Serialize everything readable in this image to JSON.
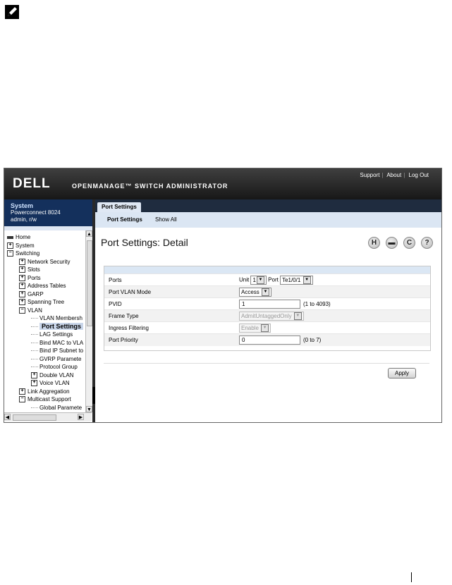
{
  "header": {
    "logo": "DELL",
    "product": "OPENMANAGE™ SWITCH ADMINISTRATOR",
    "links": [
      "Support",
      "About",
      "Log Out"
    ]
  },
  "system_panel": {
    "title": "System",
    "model": "Powerconnect 8024",
    "user": "admin, r/w"
  },
  "tree": [
    {
      "label": "Home",
      "indent": 0,
      "icon": "home"
    },
    {
      "label": "System",
      "indent": 0,
      "icon": "plus"
    },
    {
      "label": "Switching",
      "indent": 0,
      "icon": "minus"
    },
    {
      "label": "Network Security",
      "indent": 1,
      "icon": "plus"
    },
    {
      "label": "Slots",
      "indent": 1,
      "icon": "plus"
    },
    {
      "label": "Ports",
      "indent": 1,
      "icon": "plus"
    },
    {
      "label": "Address Tables",
      "indent": 1,
      "icon": "plus"
    },
    {
      "label": "GARP",
      "indent": 1,
      "icon": "plus"
    },
    {
      "label": "Spanning Tree",
      "indent": 1,
      "icon": "plus"
    },
    {
      "label": "VLAN",
      "indent": 1,
      "icon": "minus"
    },
    {
      "label": "VLAN Membersh",
      "indent": 2,
      "icon": "none"
    },
    {
      "label": "Port Settings",
      "indent": 2,
      "icon": "none",
      "selected": true
    },
    {
      "label": "LAG Settings",
      "indent": 2,
      "icon": "none"
    },
    {
      "label": "Bind MAC to VLA",
      "indent": 2,
      "icon": "none"
    },
    {
      "label": "Bind IP Subnet to",
      "indent": 2,
      "icon": "none"
    },
    {
      "label": "GVRP Paramete",
      "indent": 2,
      "icon": "none"
    },
    {
      "label": "Protocol Group",
      "indent": 2,
      "icon": "none"
    },
    {
      "label": "Double VLAN",
      "indent": 2,
      "icon": "plus"
    },
    {
      "label": "Voice VLAN",
      "indent": 2,
      "icon": "plus"
    },
    {
      "label": "Link Aggregation",
      "indent": 1,
      "icon": "plus"
    },
    {
      "label": "Multicast Support",
      "indent": 1,
      "icon": "minus"
    },
    {
      "label": "Global Paramete",
      "indent": 2,
      "icon": "none"
    }
  ],
  "tabs": {
    "main": "Port Settings",
    "sub": [
      "Port Settings",
      "Show All"
    ]
  },
  "page_title": "Port Settings: Detail",
  "toolbar_icons": [
    "H",
    "print",
    "C",
    "?"
  ],
  "form": {
    "ports": {
      "label": "Ports",
      "unit_label": "Unit",
      "unit_value": "1",
      "port_label": "Port",
      "port_value": "Te1/0/1"
    },
    "mode": {
      "label": "Port VLAN Mode",
      "value": "Access"
    },
    "pvid": {
      "label": "PVID",
      "value": "1",
      "hint": "(1 to 4093)"
    },
    "frame": {
      "label": "Frame Type",
      "value": "AdmitUntaggedOnly"
    },
    "ingress": {
      "label": "Ingress Filtering",
      "value": "Enable"
    },
    "priority": {
      "label": "Port Priority",
      "value": "0",
      "hint": "(0 to 7)"
    }
  },
  "apply_label": "Apply"
}
